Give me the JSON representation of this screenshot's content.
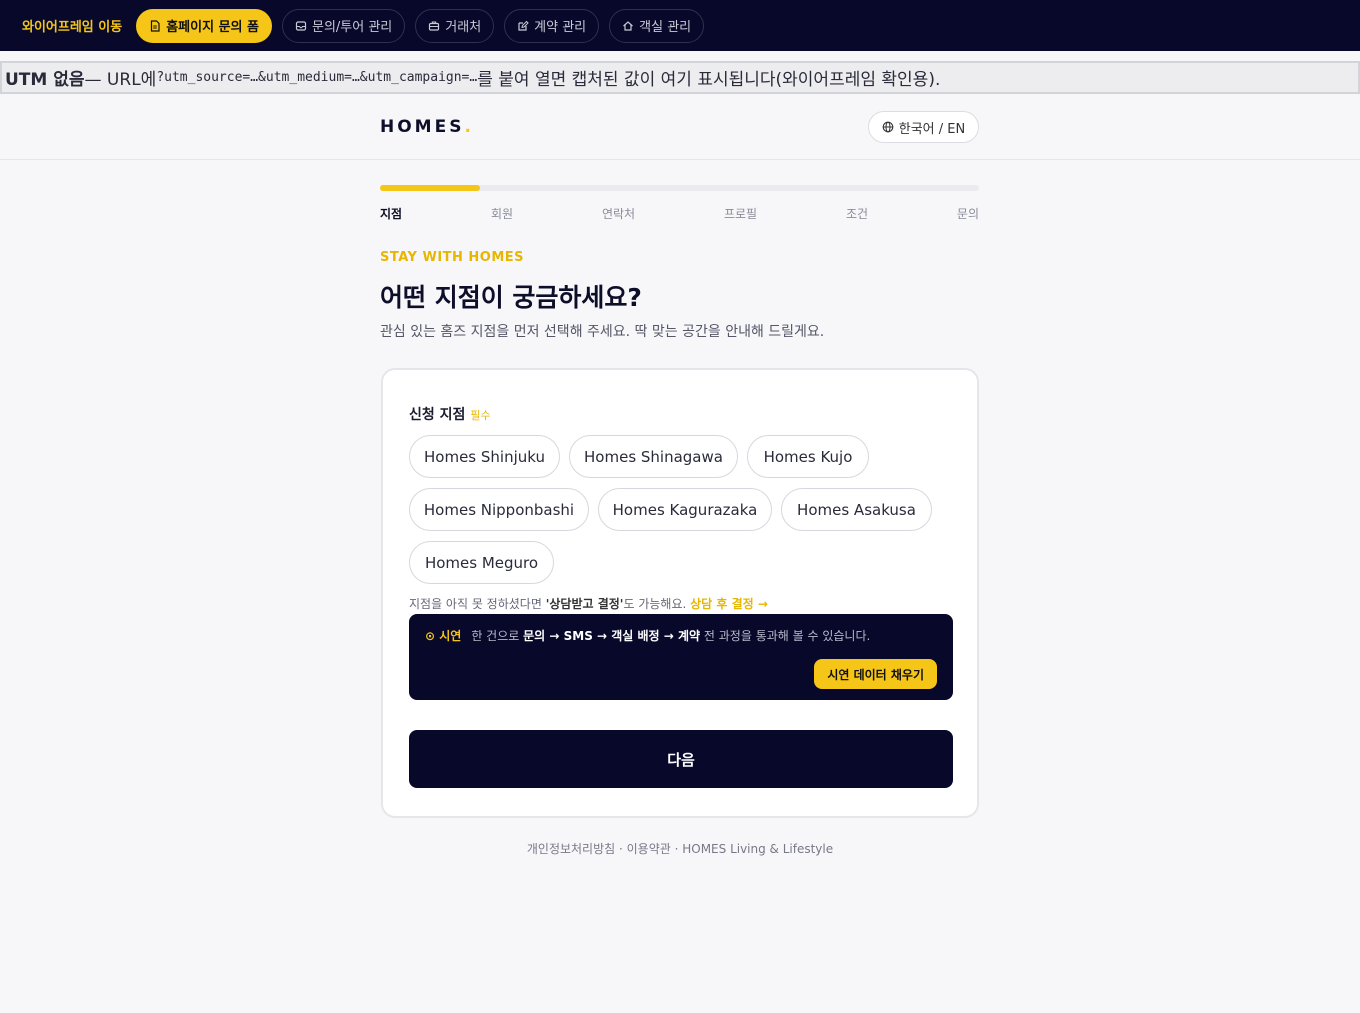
{
  "topnav": {
    "title": "와이어프레임 이동",
    "items": [
      {
        "label": "홈페이지 문의 폼",
        "icon": "document-icon",
        "active": true
      },
      {
        "label": "문의/투어 관리",
        "icon": "inbox-icon",
        "active": false
      },
      {
        "label": "거래처",
        "icon": "briefcase-icon",
        "active": false
      },
      {
        "label": "계약 관리",
        "icon": "edit-icon",
        "active": false
      },
      {
        "label": "객실 관리",
        "icon": "home-icon",
        "active": false
      }
    ]
  },
  "utm_banner": {
    "prefix": "UTM 없음",
    "mid": " — URL에 ",
    "code": "?utm_source=…&utm_medium=…&utm_campaign=…",
    "suffix": "를 붙여 열면 캡처된 값이 여기 표시됩니다(와이어프레임 확인용)."
  },
  "header": {
    "logo": "HOMES",
    "logo_dot": ".",
    "lang_label": "한국어 / EN"
  },
  "progress": {
    "fraction": 0.167,
    "steps": [
      "지점",
      "회원",
      "연락처",
      "프로필",
      "조건",
      "문의"
    ],
    "current": 0
  },
  "hero": {
    "eyebrow": "STAY WITH HOMES",
    "title": "어떤 지점이 궁금하세요?",
    "subtitle": "관심 있는 홈즈 지점을 먼저 선택해 주세요. 딱 맞는 공간을 안내해 드릴게요."
  },
  "form": {
    "label": "신청 지점",
    "required": "필수",
    "branches": [
      "Homes Shinjuku",
      "Homes Shinagawa",
      "Homes Kujo",
      "Homes Nipponbashi",
      "Homes Kagurazaka",
      "Homes Asakusa",
      "Homes Meguro"
    ],
    "hint_pre": "지점을 아직 못 정하셨다면 ",
    "hint_bold": "'상담받고 결정'",
    "hint_post": "도 가능해요. ",
    "hint_link": "상담 후 결정 →"
  },
  "demo": {
    "tag": "시연",
    "text_pre": "한 건으로 ",
    "flow": "문의 → SMS → 객실 배정 → 계약",
    "text_post": " 전 과정을 통과해 볼 수 있습니다.",
    "button": "시연 데이터 채우기"
  },
  "next_button": "다음",
  "footer": "개인정보처리방침 · 이용약관 · HOMES Living & Lifestyle",
  "colors": {
    "accent": "#f5c518",
    "navy": "#07082a"
  }
}
